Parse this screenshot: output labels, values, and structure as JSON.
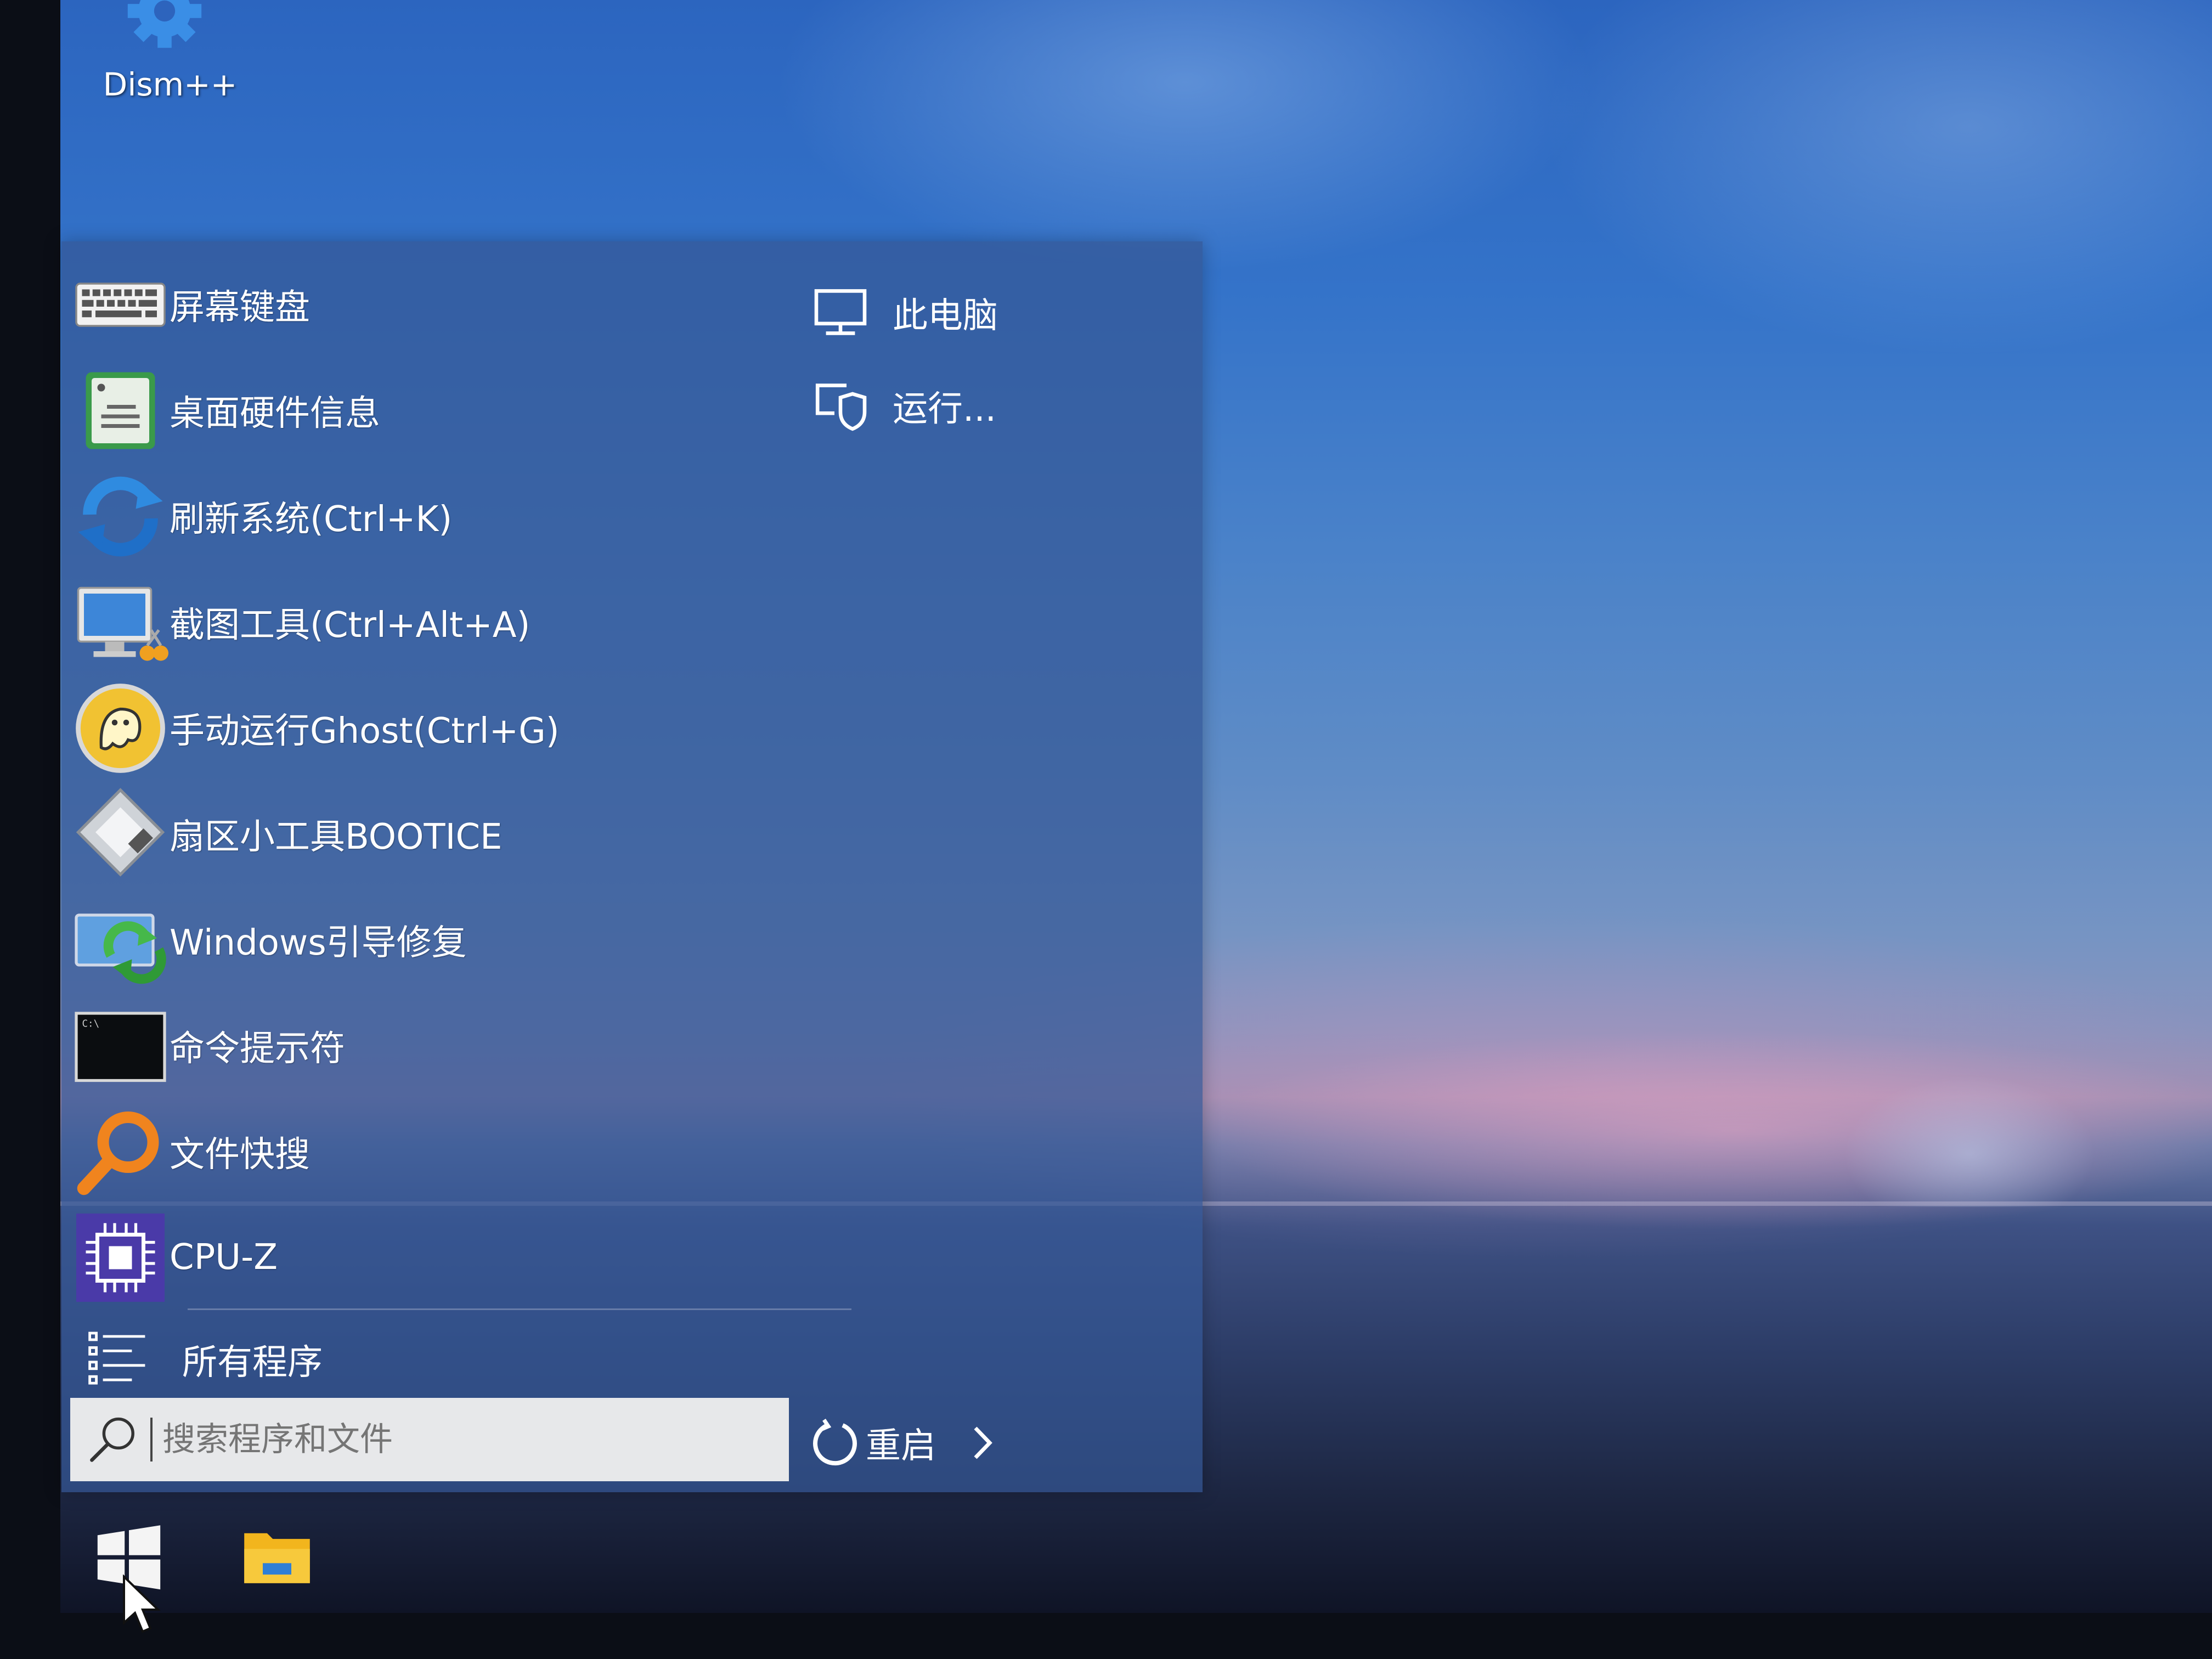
{
  "desktop": {
    "icons": [
      {
        "label": "Dism++",
        "icon": "gear-icon"
      }
    ]
  },
  "start_menu": {
    "pinned": [
      {
        "label": "屏幕键盘",
        "icon": "keyboard-icon"
      },
      {
        "label": "桌面硬件信息",
        "icon": "hardware-info-icon"
      },
      {
        "label": "刷新系统(Ctrl+K)",
        "icon": "refresh-icon"
      },
      {
        "label": "截图工具(Ctrl+Alt+A)",
        "icon": "screenshot-icon"
      },
      {
        "label": "手动运行Ghost(Ctrl+G)",
        "icon": "ghost-icon"
      },
      {
        "label": "扇区小工具BOOTICE",
        "icon": "disk-tool-icon"
      },
      {
        "label": "Windows引导修复",
        "icon": "boot-repair-icon"
      },
      {
        "label": "命令提示符",
        "icon": "terminal-icon"
      },
      {
        "label": "文件快搜",
        "icon": "magnifier-icon"
      },
      {
        "label": "CPU-Z",
        "icon": "cpu-icon"
      }
    ],
    "all_programs": {
      "label": "所有程序",
      "icon": "list-icon"
    },
    "search": {
      "placeholder": "搜索程序和文件",
      "icon": "search-icon"
    },
    "power": {
      "label": "重启",
      "icon": "power-icon"
    },
    "right_column": [
      {
        "label": "此电脑",
        "icon": "computer-icon"
      },
      {
        "label": "运行...",
        "icon": "run-icon"
      }
    ]
  },
  "taskbar": {
    "items": [
      {
        "name": "start",
        "icon": "windows-logo-icon"
      },
      {
        "name": "file-explorer",
        "icon": "folder-icon"
      }
    ]
  },
  "colors": {
    "menu_background": "#345896",
    "search_background": "#e7e8ea",
    "text": "#ffffff"
  }
}
